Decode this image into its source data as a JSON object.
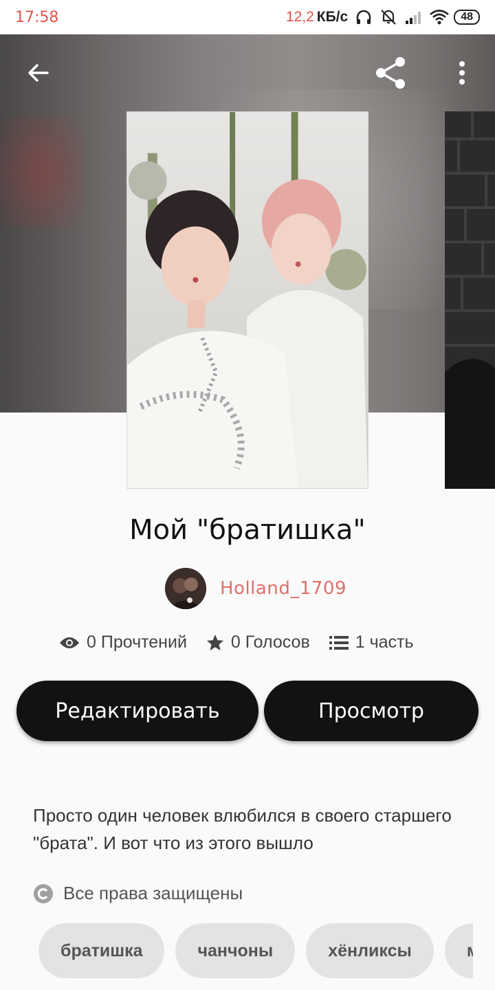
{
  "status_bar": {
    "time": "17:58",
    "net_speed_value": "12,2",
    "net_speed_unit": "КБ/с",
    "battery": "48"
  },
  "toolbar": {
    "back_icon": "arrow-left-icon",
    "share_icon": "share-icon",
    "more_icon": "more-vertical-icon"
  },
  "story": {
    "title": "Мой \"братишка\"",
    "author_name": "Holland_1709",
    "stats": {
      "reads": "0 Прочтений",
      "votes": "0 Голосов",
      "parts": "1 часть"
    },
    "edit_label": "Редактировать",
    "view_label": "Просмотр",
    "description": "Просто один человек влюбился в своего старшего \"брата\". И вот что из этого вышло",
    "copyright": "Все права защищены",
    "tags": [
      "братишка",
      "чанчоны",
      "хёнликсы",
      "м"
    ]
  },
  "colors": {
    "accent_red": "#e2524c",
    "author_color": "#e0706c",
    "button_bg": "#121212",
    "tag_bg": "#e3e3e3"
  }
}
